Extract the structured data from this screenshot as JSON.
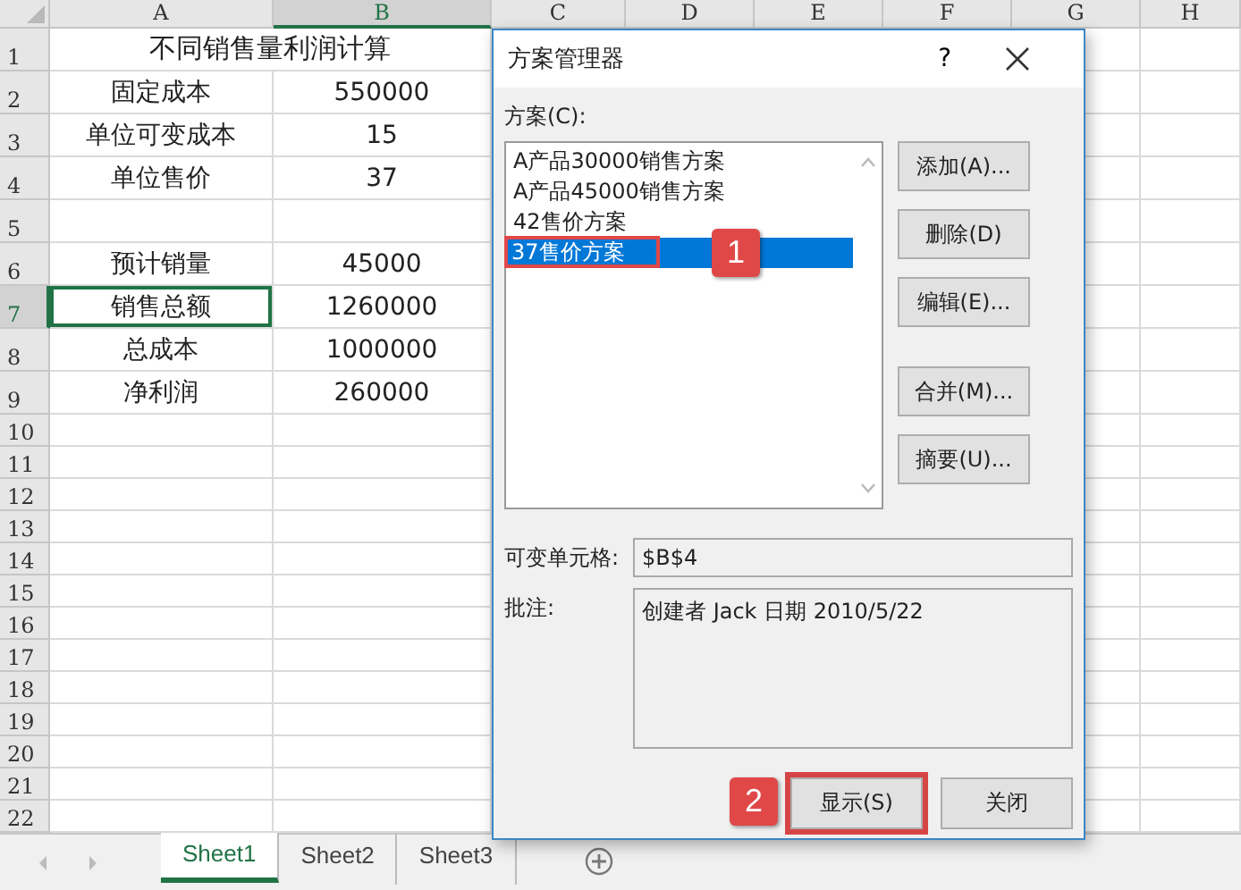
{
  "sheet": {
    "columns": [
      {
        "label": "A",
        "selected": false
      },
      {
        "label": "B",
        "selected": true
      },
      {
        "label": "C",
        "selected": false
      },
      {
        "label": "D",
        "selected": false
      },
      {
        "label": "E",
        "selected": false
      },
      {
        "label": "F",
        "selected": false
      },
      {
        "label": "G",
        "selected": false
      },
      {
        "label": "H",
        "selected": false
      }
    ],
    "rows": [
      {
        "number": "1",
        "selected": false,
        "title": "不同销售量利润计算"
      },
      {
        "number": "2",
        "selected": false,
        "cells": [
          "固定成本",
          "550000"
        ]
      },
      {
        "number": "3",
        "selected": false,
        "cells": [
          "单位可变成本",
          "15"
        ]
      },
      {
        "number": "4",
        "selected": false,
        "cells": [
          "单位售价",
          "37"
        ]
      },
      {
        "number": "5",
        "selected": false
      },
      {
        "number": "6",
        "selected": false,
        "cells": [
          "预计销量",
          "45000"
        ]
      },
      {
        "number": "7",
        "selected": true,
        "cells": [
          "销售总额",
          "1260000"
        ]
      },
      {
        "number": "8",
        "selected": false,
        "cells": [
          "总成本",
          "1000000"
        ]
      },
      {
        "number": "9",
        "selected": false,
        "cells": [
          "净利润",
          "260000"
        ]
      },
      {
        "number": "10",
        "selected": false
      },
      {
        "number": "11",
        "selected": false
      },
      {
        "number": "12",
        "selected": false
      },
      {
        "number": "13",
        "selected": false
      },
      {
        "number": "14",
        "selected": false
      },
      {
        "number": "15",
        "selected": false
      },
      {
        "number": "16",
        "selected": false
      },
      {
        "number": "17",
        "selected": false
      },
      {
        "number": "18",
        "selected": false
      },
      {
        "number": "19",
        "selected": false
      },
      {
        "number": "20",
        "selected": false
      },
      {
        "number": "21",
        "selected": false
      },
      {
        "number": "22",
        "selected": false
      }
    ],
    "tabs": [
      {
        "label": "Sheet1",
        "selected": true
      },
      {
        "label": "Sheet2",
        "selected": false
      },
      {
        "label": "Sheet3",
        "selected": false
      }
    ]
  },
  "dialog": {
    "title": "方案管理器",
    "help": "?",
    "list_label": "方案(C):",
    "scenarios": [
      {
        "label": "A产品30000销售方案",
        "selected": false
      },
      {
        "label": "A产品45000销售方案",
        "selected": false
      },
      {
        "label": "42售价方案",
        "selected": false
      },
      {
        "label": "37售价方案",
        "selected": true,
        "callout": "1"
      }
    ],
    "side_buttons": [
      [
        "添加(A)...",
        "删除(D)",
        "编辑(E)..."
      ],
      [
        "合并(M)...",
        "摘要(U)..."
      ]
    ],
    "changing_cells": {
      "label": "可变单元格:",
      "value": "$B$4"
    },
    "comment": {
      "label": "批注:",
      "value": "创建者 Jack 日期 2010/5/22"
    },
    "buttons": [
      {
        "label": "显示(S)",
        "callout": "2"
      },
      {
        "label": "关闭"
      }
    ]
  }
}
